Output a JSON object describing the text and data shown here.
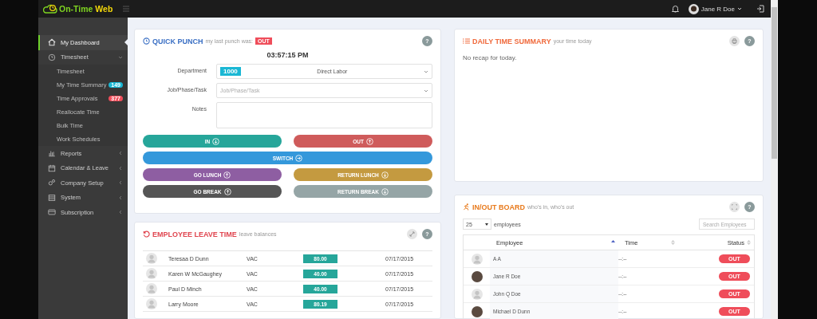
{
  "topbar": {
    "logo_first": "On-Time",
    "logo_second": "Web",
    "user_name": "Jane R Doe"
  },
  "sidebar": {
    "items": [
      {
        "label": "My Dashboard",
        "selected": true
      },
      {
        "label": "Timesheet",
        "selected": false,
        "expanded": true,
        "children": [
          {
            "label": "Timesheet"
          },
          {
            "label": "My Time Summary",
            "badge": {
              "text": "149",
              "color": "#1ab7d4"
            }
          },
          {
            "label": "Time Approvals",
            "badge": {
              "text": "377",
              "color": "#ef4d5a"
            }
          },
          {
            "label": "Reallocate Time"
          },
          {
            "label": "Bulk Time"
          },
          {
            "label": "Work Schedules"
          }
        ]
      },
      {
        "label": "Reports",
        "selected": false,
        "expanded": false
      },
      {
        "label": "Calendar & Leave",
        "selected": false,
        "expanded": false
      },
      {
        "label": "Company Setup",
        "selected": false,
        "expanded": false
      },
      {
        "label": "System",
        "selected": false,
        "expanded": false
      },
      {
        "label": "Subscription",
        "selected": false,
        "expanded": false
      }
    ]
  },
  "quick_punch": {
    "title": "QUICK PUNCH",
    "subtitle": "my last punch was:",
    "last_punch": "OUT",
    "help": "?",
    "time": "03:57:15 PM",
    "department": {
      "label": "Department",
      "code": "1000",
      "value": "Direct Labor"
    },
    "job": {
      "label": "Job/Phase/Task",
      "placeholder": "Job/Phase/Task"
    },
    "notes": {
      "label": "Notes"
    },
    "buttons": [
      {
        "label": "IN",
        "kind": "half",
        "color": "#26a69a"
      },
      {
        "label": "OUT",
        "kind": "half",
        "color": "#cf5b5b"
      },
      {
        "label": "SWITCH",
        "kind": "full",
        "color": "#3498db"
      },
      {
        "label": "GO LUNCH",
        "kind": "half",
        "color": "#8e5ea2"
      },
      {
        "label": "RETURN LUNCH",
        "kind": "half",
        "color": "#c49a40"
      },
      {
        "label": "GO BREAK",
        "kind": "half",
        "color": "#555555"
      },
      {
        "label": "RETURN BREAK",
        "kind": "half",
        "color": "#95a5a6"
      }
    ]
  },
  "daily_summary": {
    "title": "DAILY TIME SUMMARY",
    "subtitle": "your time today",
    "help": "?",
    "message": "No recap for today."
  },
  "leave_time": {
    "title": "EMPLOYEE LEAVE TIME",
    "subtitle": "leave balances",
    "help": "?",
    "rows": [
      {
        "name": "Teresaa D Dunn",
        "type": "VAC",
        "balance": "80.00",
        "date": "07/17/2015"
      },
      {
        "name": "Karen W McGaughey",
        "type": "VAC",
        "balance": "40.00",
        "date": "07/17/2015"
      },
      {
        "name": "Paul D Minch",
        "type": "VAC",
        "balance": "40.00",
        "date": "07/17/2015"
      },
      {
        "name": "Larry Moore",
        "type": "VAC",
        "balance": "80.19",
        "date": "07/17/2015"
      }
    ]
  },
  "inout_board": {
    "title": "IN/OUT BOARD",
    "subtitle": "who's in, who's out",
    "help": "?",
    "page_size": "25",
    "page_size_label": "employees",
    "search_placeholder": "Search Employees",
    "columns": [
      {
        "label": "Employee",
        "sorted": true
      },
      {
        "label": "Time",
        "sorted": false
      },
      {
        "label": "Status",
        "sorted": false
      }
    ],
    "rows": [
      {
        "name": "A A",
        "kind": "default",
        "time": "--:--",
        "status": "OUT"
      },
      {
        "name": "Jane R Doe",
        "kind": "photo",
        "time": "--:--",
        "status": "OUT"
      },
      {
        "name": "John Q Doe",
        "kind": "default",
        "time": "--:--",
        "status": "OUT"
      },
      {
        "name": "Michael D Dunn",
        "kind": "photo",
        "time": "--:--",
        "status": "OUT"
      }
    ]
  }
}
